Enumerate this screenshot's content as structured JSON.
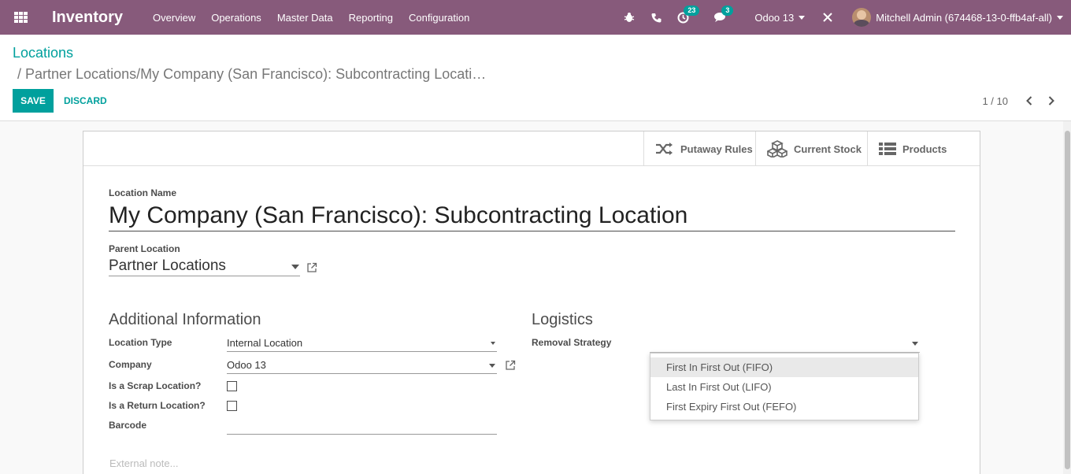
{
  "navbar": {
    "app_title": "Inventory",
    "menu": [
      "Overview",
      "Operations",
      "Master Data",
      "Reporting",
      "Configuration"
    ],
    "activity_count": "23",
    "message_count": "3",
    "company": "Odoo 13",
    "user": "Mitchell Admin (674468-13-0-ffb4af-all)",
    "accent_color": "#875a7b"
  },
  "breadcrumb": {
    "parent": "Locations",
    "current": "/  Partner Locations/My Company (San Francisco): Subcontracting Locati…"
  },
  "actions": {
    "save": "SAVE",
    "discard": "DISCARD"
  },
  "pager": {
    "value": "1 / 10"
  },
  "smart_buttons": {
    "putaway": "Putaway Rules",
    "stock": "Current Stock",
    "products": "Products"
  },
  "form": {
    "name_label": "Location Name",
    "name_value": "My Company (San Francisco): Subcontracting Location",
    "parent_label": "Parent Location",
    "parent_value": "Partner Locations",
    "additional_title": "Additional Information",
    "logistics_title": "Logistics",
    "type_label": "Location Type",
    "type_value": "Internal Location",
    "company_label": "Company",
    "company_value": "Odoo 13",
    "scrap_label": "Is a Scrap Location?",
    "return_label": "Is a Return Location?",
    "barcode_label": "Barcode",
    "removal_label": "Removal Strategy",
    "note_placeholder": "External note..."
  },
  "removal_options": [
    "First In First Out (FIFO)",
    "Last In First Out (LIFO)",
    "First Expiry First Out (FEFO)"
  ],
  "brand_teal": "#00a09d"
}
